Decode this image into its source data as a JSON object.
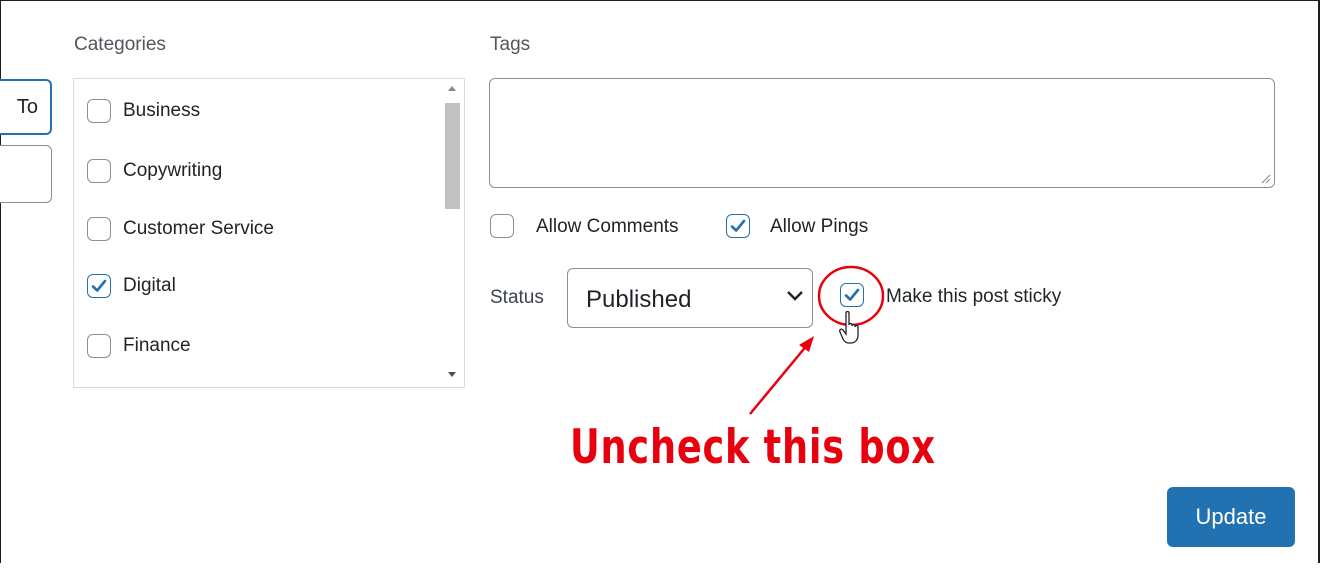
{
  "left_partial": {
    "button_label": "To"
  },
  "categories": {
    "heading": "Categories",
    "items": [
      {
        "label": "Business",
        "checked": false
      },
      {
        "label": "Copywriting",
        "checked": false
      },
      {
        "label": "Customer Service",
        "checked": false
      },
      {
        "label": "Digital",
        "checked": true
      },
      {
        "label": "Finance",
        "checked": false
      }
    ]
  },
  "tags": {
    "heading": "Tags",
    "value": ""
  },
  "options": {
    "allow_comments": {
      "label": "Allow Comments",
      "checked": false
    },
    "allow_pings": {
      "label": "Allow Pings",
      "checked": true
    }
  },
  "status": {
    "label": "Status",
    "selected": "Published",
    "sticky": {
      "label": "Make this post sticky",
      "checked": true
    }
  },
  "annotation": {
    "text": "Uncheck this box",
    "color": "#e8000e"
  },
  "update_button": {
    "label": "Update"
  },
  "colors": {
    "accent": "#2271b1",
    "annotation": "#e8000e"
  }
}
